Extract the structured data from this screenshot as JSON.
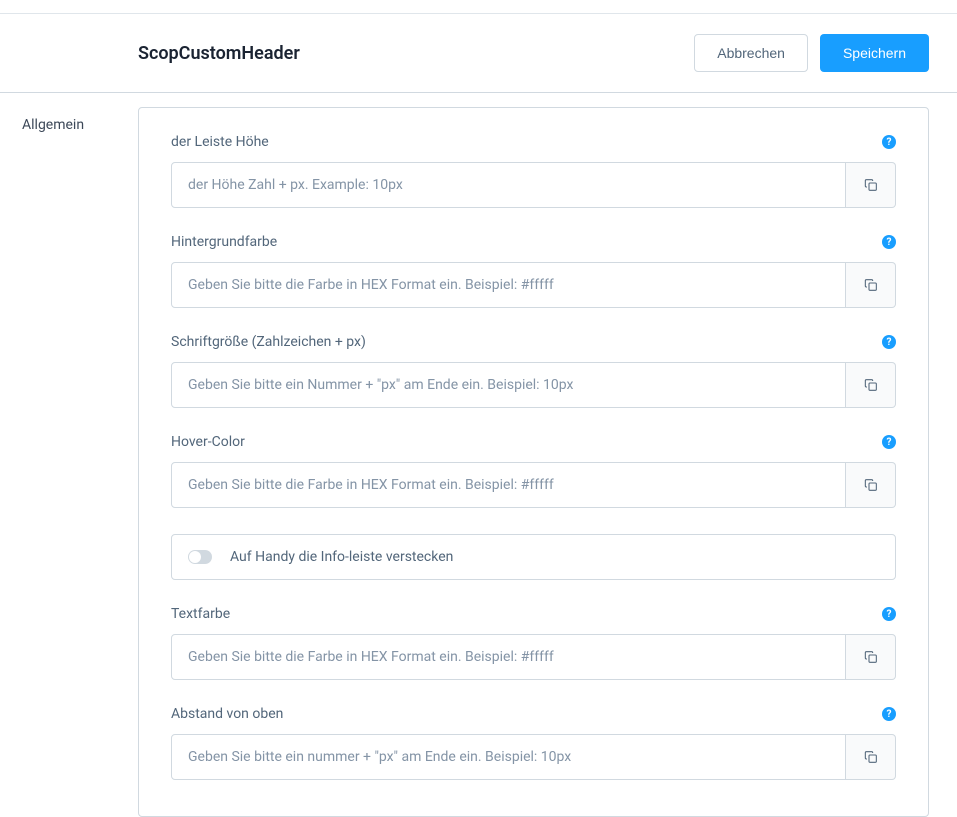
{
  "header": {
    "title": "ScopCustomHeader",
    "cancel_label": "Abbrechen",
    "save_label": "Speichern"
  },
  "sidebar": {
    "tab": "Allgemein"
  },
  "fields": {
    "height": {
      "label": "der Leiste Höhe",
      "placeholder": "der Höhe Zahl + px. Example: 10px"
    },
    "background": {
      "label": "Hintergrundfarbe",
      "placeholder": "Geben Sie bitte die Farbe in HEX Format ein. Beispiel: #fffff"
    },
    "fontsize": {
      "label": "Schriftgröße (Zahlzeichen + px)",
      "placeholder": "Geben Sie bitte ein Nummer + \"px\" am Ende ein. Beispiel: 10px"
    },
    "hovercolor": {
      "label": "Hover-Color",
      "placeholder": "Geben Sie bitte die Farbe in HEX Format ein. Beispiel: #fffff"
    },
    "hidemobile": {
      "label": "Auf Handy die Info-leiste verstecken"
    },
    "textcolor": {
      "label": "Textfarbe",
      "placeholder": "Geben Sie bitte die Farbe in HEX Format ein. Beispiel: #fffff"
    },
    "topmargin": {
      "label": "Abstand von oben",
      "placeholder": "Geben Sie bitte ein nummer + \"px\" am Ende ein. Beispiel: 10px"
    }
  }
}
